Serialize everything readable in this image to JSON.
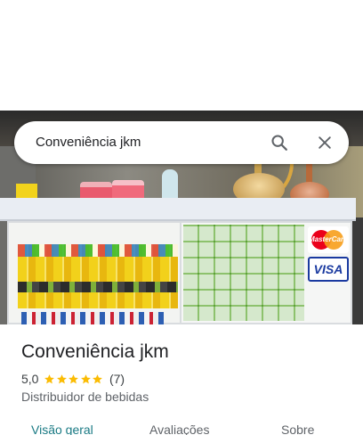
{
  "search": {
    "query": "Conveniência jkm",
    "search_icon": "search-icon",
    "clear_icon": "close-icon"
  },
  "photo": {
    "card_brands": [
      "MasterCard",
      "VISA"
    ]
  },
  "place": {
    "name": "Conveniência jkm",
    "rating": "5,0",
    "stars": 5,
    "review_count": "(7)",
    "category": "Distribuidor de bebidas"
  },
  "tabs": [
    {
      "label": "Visão geral",
      "active": true
    },
    {
      "label": "Avaliações",
      "active": false
    },
    {
      "label": "Sobre",
      "active": false
    }
  ],
  "colors": {
    "accent": "#1a7a84",
    "star": "#fbbc04",
    "text_primary": "#202124",
    "text_secondary": "#5f6368"
  }
}
